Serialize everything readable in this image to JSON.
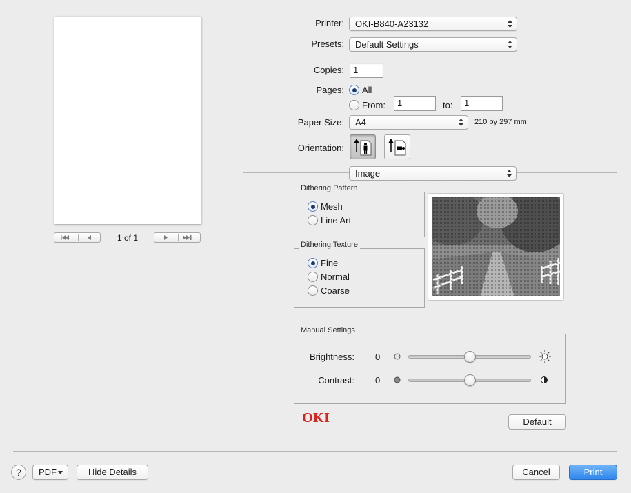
{
  "preview": {
    "page_indicator": "1 of 1"
  },
  "printer": {
    "label": "Printer:",
    "value": "OKI-B840-A23132"
  },
  "presets": {
    "label": "Presets:",
    "value": "Default Settings"
  },
  "copies": {
    "label": "Copies:",
    "value": "1"
  },
  "pages": {
    "label": "Pages:",
    "all_label": "All",
    "from_label": "From:",
    "from_value": "1",
    "to_label": "to:",
    "to_value": "1"
  },
  "paper_size": {
    "label": "Paper Size:",
    "value": "A4",
    "dimensions": "210 by 297 mm"
  },
  "orientation": {
    "label": "Orientation:"
  },
  "section_menu": {
    "value": "Image"
  },
  "dithering_pattern": {
    "title": "Dithering Pattern",
    "options": [
      "Mesh",
      "Line Art"
    ],
    "selected": "Mesh"
  },
  "dithering_texture": {
    "title": "Dithering Texture",
    "options": [
      "Fine",
      "Normal",
      "Coarse"
    ],
    "selected": "Fine"
  },
  "manual_settings": {
    "title": "Manual Settings",
    "brightness_label": "Brightness:",
    "brightness_value": "0",
    "contrast_label": "Contrast:",
    "contrast_value": "0"
  },
  "brand": {
    "logo_text": "OKI",
    "color": "#d8231f"
  },
  "buttons": {
    "default": "Default",
    "help": "?",
    "pdf": "PDF",
    "hide_details": "Hide Details",
    "cancel": "Cancel",
    "print": "Print"
  },
  "colors": {
    "accent": "#2f86ed",
    "background": "#ececec"
  }
}
